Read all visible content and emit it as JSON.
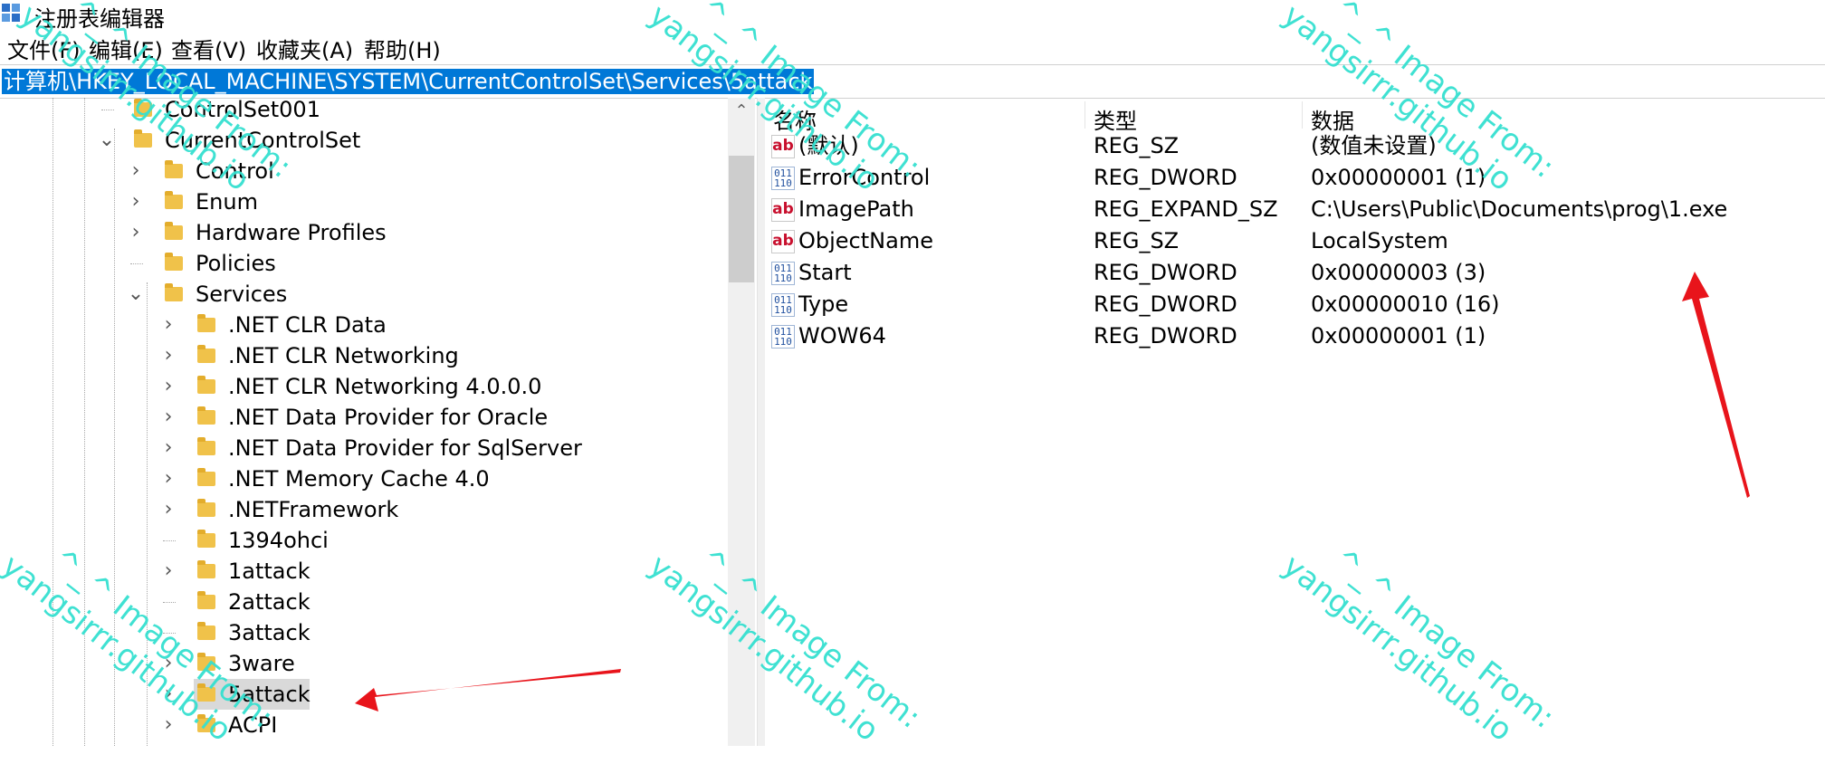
{
  "window": {
    "title": "注册表编辑器"
  },
  "menu": [
    "文件(F)",
    "编辑(E)",
    "查看(V)",
    "收藏夹(A)",
    "帮助(H)"
  ],
  "address": "计算机\\HKEY_LOCAL_MACHINE\\SYSTEM\\CurrentControlSet\\Services\\5attack",
  "tree": [
    {
      "label": "ControlSet001",
      "expander": "none"
    },
    {
      "label": "CurrentControlSet",
      "expander": "expanded"
    },
    {
      "label": "Control",
      "expander": "collapsed"
    },
    {
      "label": "Enum",
      "expander": "collapsed"
    },
    {
      "label": "Hardware Profiles",
      "expander": "collapsed"
    },
    {
      "label": "Policies",
      "expander": "none"
    },
    {
      "label": "Services",
      "expander": "expanded"
    },
    {
      "label": ".NET CLR Data",
      "expander": "collapsed"
    },
    {
      "label": ".NET CLR Networking",
      "expander": "collapsed"
    },
    {
      "label": ".NET CLR Networking 4.0.0.0",
      "expander": "collapsed"
    },
    {
      "label": ".NET Data Provider for Oracle",
      "expander": "collapsed"
    },
    {
      "label": ".NET Data Provider for SqlServer",
      "expander": "collapsed"
    },
    {
      "label": ".NET Memory Cache 4.0",
      "expander": "collapsed"
    },
    {
      "label": ".NETFramework",
      "expander": "collapsed"
    },
    {
      "label": "1394ohci",
      "expander": "none"
    },
    {
      "label": "1attack",
      "expander": "collapsed"
    },
    {
      "label": "2attack",
      "expander": "none"
    },
    {
      "label": "3attack",
      "expander": "none"
    },
    {
      "label": "3ware",
      "expander": "collapsed"
    },
    {
      "label": "5attack",
      "expander": "collapsed",
      "selected": true
    },
    {
      "label": "ACPI",
      "expander": "collapsed"
    }
  ],
  "columns": {
    "name": "名称",
    "type": "类型",
    "data": "数据"
  },
  "values": [
    {
      "icon": "string-value-icon",
      "name": "(默认)",
      "type": "REG_SZ",
      "data": "(数值未设置)"
    },
    {
      "icon": "dword-value-icon",
      "name": "ErrorControl",
      "type": "REG_DWORD",
      "data": "0x00000001 (1)"
    },
    {
      "icon": "string-value-icon",
      "name": "ImagePath",
      "type": "REG_EXPAND_SZ",
      "data": "C:\\Users\\Public\\Documents\\prog\\1.exe"
    },
    {
      "icon": "string-value-icon",
      "name": "ObjectName",
      "type": "REG_SZ",
      "data": "LocalSystem"
    },
    {
      "icon": "dword-value-icon",
      "name": "Start",
      "type": "REG_DWORD",
      "data": "0x00000003 (3)"
    },
    {
      "icon": "dword-value-icon",
      "name": "Type",
      "type": "REG_DWORD",
      "data": "0x00000010 (16)"
    },
    {
      "icon": "dword-value-icon",
      "name": "WOW64",
      "type": "REG_DWORD",
      "data": "0x00000001 (1)"
    }
  ],
  "icons": {
    "string": "ab",
    "dword": "011\n110"
  },
  "watermark": {
    "line1": "^_^ Image From:",
    "line2": "yangsirrr.github.io"
  },
  "colors": {
    "selection": "#0078d7",
    "folder": "#f0c24a",
    "watermark": "#35e0d0",
    "arrow": "#e8141b"
  }
}
